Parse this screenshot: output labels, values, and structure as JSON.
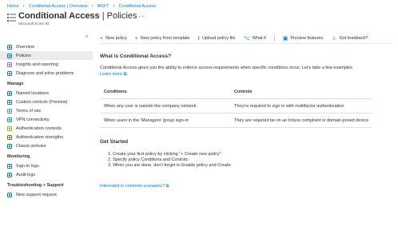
{
  "breadcrumb": [
    "Home",
    "Conditional Access | Overview",
    "MSFT",
    "Conditional Access"
  ],
  "page": {
    "title_bold": "Conditional Access",
    "title_rest": " | Policies",
    "subtitle": "Microsoft Entra ID",
    "more": "···"
  },
  "sidebar": {
    "collapse": "«",
    "top_items": [
      {
        "label": "Overview",
        "icon": "overview-icon",
        "color": "#0078d4",
        "selected": false
      },
      {
        "label": "Policies",
        "icon": "policies-icon",
        "color": "#0078d4",
        "selected": true
      },
      {
        "label": "Insights and reporting",
        "icon": "insights-icon",
        "color": "#8764b8",
        "selected": false
      },
      {
        "label": "Diagnose and solve problems",
        "icon": "diagnose-icon",
        "color": "#0078d4",
        "selected": false
      }
    ],
    "sections": [
      {
        "title": "Manage",
        "items": [
          {
            "label": "Named locations",
            "icon": "named-locations-icon",
            "color": "#0078d4"
          },
          {
            "label": "Custom controls (Preview)",
            "icon": "custom-controls-icon",
            "color": "#0078d4"
          },
          {
            "label": "Terms of use",
            "icon": "terms-of-use-icon",
            "color": "#3a96dd"
          },
          {
            "label": "VPN connectivity",
            "icon": "vpn-icon",
            "color": "#00a2ad"
          },
          {
            "label": "Authentication contexts",
            "icon": "auth-contexts-icon",
            "color": "#8cbd18"
          },
          {
            "label": "Authentication strengths",
            "icon": "auth-strengths-icon",
            "color": "#498205"
          },
          {
            "label": "Classic policies",
            "icon": "classic-policies-icon",
            "color": "#0078d4"
          }
        ]
      },
      {
        "title": "Monitoring",
        "items": [
          {
            "label": "Sign-in logs",
            "icon": "sign-in-logs-icon",
            "color": "#0078d4"
          },
          {
            "label": "Audit logs",
            "icon": "audit-logs-icon",
            "color": "#0078d4"
          }
        ]
      },
      {
        "title": "Troubleshooting + Support",
        "items": [
          {
            "label": "New support request",
            "icon": "support-request-icon",
            "color": "#0078d4"
          }
        ]
      }
    ]
  },
  "toolbar": {
    "new_policy": "New policy",
    "new_from_template": "New policy from template",
    "upload": "Upload policy file",
    "what_if": "What if",
    "preview": "Preview features",
    "feedback": "Got feedback?"
  },
  "main": {
    "what_heading": "What is Conditional Access?",
    "what_text": "Conditional Access gives you the ability to enforce access requirements when specific conditions occur. Let's take a few examples",
    "learn_more": "Learn more",
    "table": {
      "headers": [
        "Conditions",
        "Controls"
      ],
      "rows": [
        [
          "When any user is outside the company network",
          "They're required to sign in with multifactor authentication"
        ],
        [
          "When users in the 'Managers' group sign-in",
          "They are required be on an Intune compliant or domain-joined device"
        ]
      ]
    },
    "started_heading": "Get Started",
    "steps": [
      "1. Create your first policy by clicking \"+ Create new policy\"",
      "2. Specify policy Conditions and Controls",
      "3. When you are done, don't forget to Enable policy and Create"
    ],
    "interested_link": "Interested in common scenarios?"
  },
  "colors": {
    "accent": "#0078d4",
    "selected_bg": "#edebe9"
  }
}
